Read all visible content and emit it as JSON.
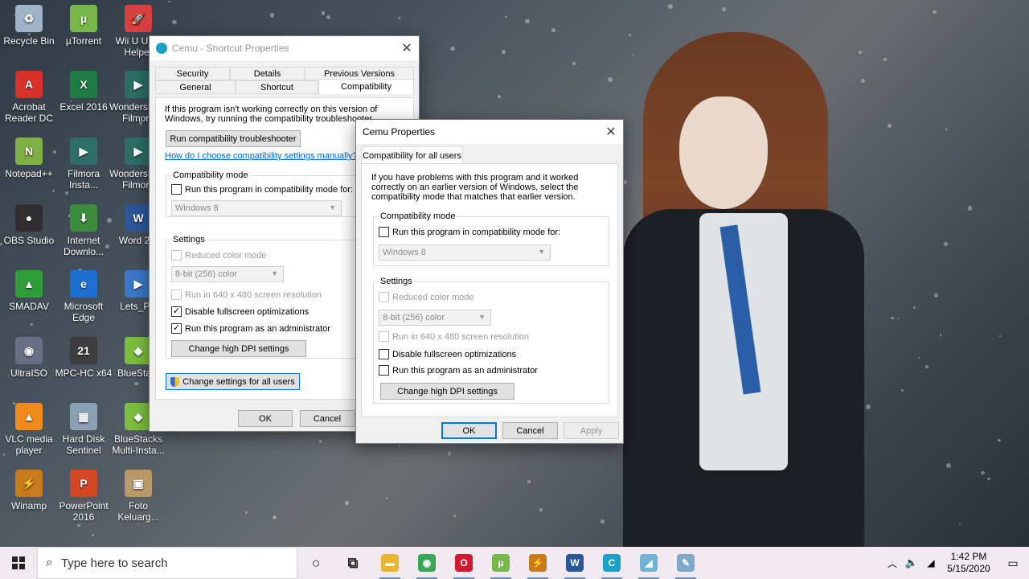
{
  "desktop": {
    "icons": [
      {
        "label": "Recycle Bin",
        "icon": "recycle-bin-icon",
        "color": "#9fb3c8",
        "glyph": "♻"
      },
      {
        "label": "µTorrent",
        "icon": "utorrent-icon",
        "color": "#78b84a",
        "glyph": "µ"
      },
      {
        "label": "Wii U USB Helper",
        "icon": "wii-u-usb-helper-icon",
        "color": "#d94040",
        "glyph": "🚀"
      },
      {
        "label": "Acrobat Reader DC",
        "icon": "acrobat-icon",
        "color": "#d8302b",
        "glyph": "A"
      },
      {
        "label": "Excel 2016",
        "icon": "excel-icon",
        "color": "#1f7a44",
        "glyph": "X"
      },
      {
        "label": "Wondershare Filmora",
        "icon": "filmora-icon",
        "color": "#2d6e66",
        "glyph": "▶"
      },
      {
        "label": "Notepad++",
        "icon": "notepadpp-icon",
        "color": "#7fb045",
        "glyph": "N"
      },
      {
        "label": "Filmora Insta...",
        "icon": "filmora-insta-icon",
        "color": "#2d6e66",
        "glyph": "▶"
      },
      {
        "label": "Wondershare Filmora",
        "icon": "filmora-icon",
        "color": "#2d6e66",
        "glyph": "▶"
      },
      {
        "label": "OBS Studio",
        "icon": "obs-icon",
        "color": "#302e31",
        "glyph": "●"
      },
      {
        "label": "Internet Downlo...",
        "icon": "idm-icon",
        "color": "#3d8b3d",
        "glyph": "⬇"
      },
      {
        "label": "Word 2...",
        "icon": "word-icon",
        "color": "#2b579a",
        "glyph": "W"
      },
      {
        "label": "SMADAV",
        "icon": "smadav-icon",
        "color": "#2f9e3a",
        "glyph": "▲"
      },
      {
        "label": "Microsoft Edge",
        "icon": "edge-icon",
        "color": "#1f6fd1",
        "glyph": "e"
      },
      {
        "label": "Lets_P...",
        "icon": "lets-icon",
        "color": "#3b78c9",
        "glyph": "▶"
      },
      {
        "label": "UltraISO",
        "icon": "ultraiso-icon",
        "color": "#6a6f86",
        "glyph": "◉"
      },
      {
        "label": "MPC-HC x64",
        "icon": "mpc-hc-icon",
        "color": "#3d3d3d",
        "glyph": "21"
      },
      {
        "label": "BlueSta...",
        "icon": "bluestacks-icon",
        "color": "#7cbf3e",
        "glyph": "◆"
      },
      {
        "label": "VLC media player",
        "icon": "vlc-icon",
        "color": "#f08a1c",
        "glyph": "▲"
      },
      {
        "label": "Hard Disk Sentinel",
        "icon": "hard-disk-sentinel-icon",
        "color": "#8aa0b4",
        "glyph": "▦"
      },
      {
        "label": "BlueStacks Multi-Insta...",
        "icon": "bluestacks-multi-icon",
        "color": "#7cbf3e",
        "glyph": "◆"
      },
      {
        "label": "Winamp",
        "icon": "winamp-icon",
        "color": "#c87b1a",
        "glyph": "⚡"
      },
      {
        "label": "PowerPoint 2016",
        "icon": "powerpoint-icon",
        "color": "#d24726",
        "glyph": "P"
      },
      {
        "label": "Foto Keluarg...",
        "icon": "photo-icon",
        "color": "#b89a6a",
        "glyph": "▣"
      }
    ]
  },
  "shortcut_props": {
    "title": "Cemu - Shortcut Properties",
    "tabs_row1": [
      "Security",
      "Details",
      "Previous Versions"
    ],
    "tabs_row2": [
      "General",
      "Shortcut",
      "Compatibility"
    ],
    "intro": "If this program isn't working correctly on this version of Windows, try running the compatibility troubleshooter.",
    "troubleshooter_btn": "Run compatibility troubleshooter",
    "help_link": "How do I choose compatibility settings manually?",
    "compat_group": "Compatibility mode",
    "compat_check": "Run this program in compatibility mode for:",
    "compat_select": "Windows 8",
    "settings_group": "Settings",
    "reduced_color": "Reduced color mode",
    "color_select": "8-bit (256) color",
    "res_640": "Run in 640 x 480 screen resolution",
    "disable_fullscreen": "Disable fullscreen optimizations",
    "run_admin": "Run this program as an administrator",
    "dpi_btn": "Change high DPI settings",
    "all_users_btn": "Change settings for all users",
    "ok": "OK",
    "cancel": "Cancel"
  },
  "cemu_props": {
    "title": "Cemu Properties",
    "tab": "Compatibility for all users",
    "intro": "If you have problems with this program and it worked correctly on an earlier version of Windows, select the compatibility mode that matches that earlier version.",
    "compat_group": "Compatibility mode",
    "compat_check": "Run this program in compatibility mode for:",
    "compat_select": "Windows 8",
    "settings_group": "Settings",
    "reduced_color": "Reduced color mode",
    "color_select": "8-bit (256) color",
    "res_640": "Run in 640 x 480 screen resolution",
    "disable_fullscreen": "Disable fullscreen optimizations",
    "run_admin": "Run this program as an administrator",
    "dpi_btn": "Change high DPI settings",
    "ok": "OK",
    "cancel": "Cancel",
    "apply": "Apply"
  },
  "taskbar": {
    "search_placeholder": "Type here to search",
    "time": "1:42 PM",
    "date": "5/15/2020",
    "apps": [
      {
        "name": "cortana",
        "icon": "cortana-icon",
        "glyph": "○",
        "color": "transparent"
      },
      {
        "name": "task-view",
        "icon": "task-view-icon",
        "glyph": "⧉",
        "color": "transparent"
      },
      {
        "name": "file-explorer",
        "icon": "folder-icon",
        "glyph": "▬",
        "color": "#e8b630"
      },
      {
        "name": "chrome",
        "icon": "chrome-icon",
        "glyph": "◉",
        "color": "#3aa757"
      },
      {
        "name": "opera",
        "icon": "opera-icon",
        "glyph": "O",
        "color": "#d21a2e"
      },
      {
        "name": "utorrent",
        "icon": "utorrent-icon",
        "glyph": "µ",
        "color": "#78b84a"
      },
      {
        "name": "winamp",
        "icon": "winamp-icon",
        "glyph": "⚡",
        "color": "#c87b1a"
      },
      {
        "name": "word",
        "icon": "word-icon",
        "glyph": "W",
        "color": "#2b579a"
      },
      {
        "name": "cemu",
        "icon": "cemu-icon",
        "glyph": "C",
        "color": "#1aa1c9"
      },
      {
        "name": "app-blue",
        "icon": "app-icon",
        "glyph": "◢",
        "color": "#6fb3d8"
      },
      {
        "name": "paint",
        "icon": "paint-icon",
        "glyph": "✎",
        "color": "#7fa9c9"
      }
    ]
  }
}
